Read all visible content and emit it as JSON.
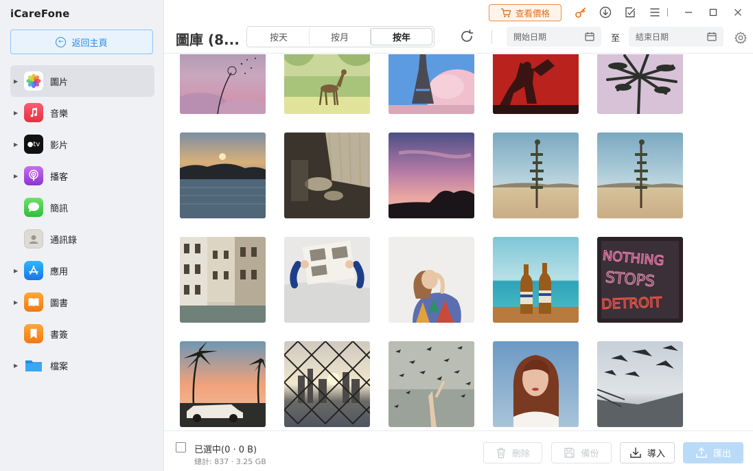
{
  "app": {
    "name": "iCareFone"
  },
  "sidebar": {
    "back_label": "返回主頁",
    "items": [
      {
        "label": "圖片",
        "icon": "photos-icon",
        "expandable": true,
        "active": true
      },
      {
        "label": "音樂",
        "icon": "music-icon",
        "expandable": true
      },
      {
        "label": "影片",
        "icon": "apple-tv-icon",
        "expandable": true
      },
      {
        "label": "播客",
        "icon": "podcast-icon",
        "expandable": true
      },
      {
        "label": "簡訊",
        "icon": "messages-icon",
        "expandable": false
      },
      {
        "label": "通訊錄",
        "icon": "contacts-icon",
        "expandable": false
      },
      {
        "label": "應用",
        "icon": "app-store-icon",
        "expandable": true
      },
      {
        "label": "圖書",
        "icon": "books-icon",
        "expandable": true
      },
      {
        "label": "書簽",
        "icon": "bookmark-icon",
        "expandable": false
      },
      {
        "label": "檔案",
        "icon": "folder-icon",
        "expandable": true
      }
    ]
  },
  "toolbar": {
    "price_label": "查看價格",
    "icons": [
      "key-icon",
      "download-icon",
      "feedback-icon",
      "menu-icon",
      "minimize-icon",
      "maximize-icon",
      "close-icon"
    ],
    "title": "圖庫 (8...",
    "view_tabs": [
      {
        "label": "按天",
        "active": false
      },
      {
        "label": "按月",
        "active": false
      },
      {
        "label": "按年",
        "active": true
      }
    ],
    "start_date_placeholder": "開始日期",
    "to_label": "至",
    "end_date_placeholder": "結束日期"
  },
  "photos": [
    {
      "name": "dandelion-sky-photo"
    },
    {
      "name": "deer-meadow-photo"
    },
    {
      "name": "eiffel-tower-blossom-photo"
    },
    {
      "name": "red-statue-photo"
    },
    {
      "name": "palm-tree-photo"
    },
    {
      "name": "sunset-lake-photo"
    },
    {
      "name": "lace-table-photo"
    },
    {
      "name": "pink-sky-trees-photo"
    },
    {
      "name": "signpost-desert-photo"
    },
    {
      "name": "signpost-desert-copy-photo"
    },
    {
      "name": "venice-buildings-photo"
    },
    {
      "name": "person-newspaper-photo"
    },
    {
      "name": "girl-colorful-sweater-photo"
    },
    {
      "name": "beer-bottles-beach-photo"
    },
    {
      "name": "nothing-stops-detroit-photo"
    },
    {
      "name": "palm-classic-car-photo"
    },
    {
      "name": "chainlink-city-photo"
    },
    {
      "name": "birds-flying-photo"
    },
    {
      "name": "woman-portrait-photo"
    },
    {
      "name": "seagulls-pier-photo"
    }
  ],
  "footer": {
    "selected_label": "已選中(0 · 0 B)",
    "total_label": "總計: 837 · 3.25 GB",
    "delete_label": "刪除",
    "backup_label": "備份",
    "import_label": "導入",
    "export_label": "匯出"
  },
  "colors": {
    "accent": "#2b8ae6",
    "price": "#e8701a",
    "sidebar_bg": "#f0f1f4"
  }
}
